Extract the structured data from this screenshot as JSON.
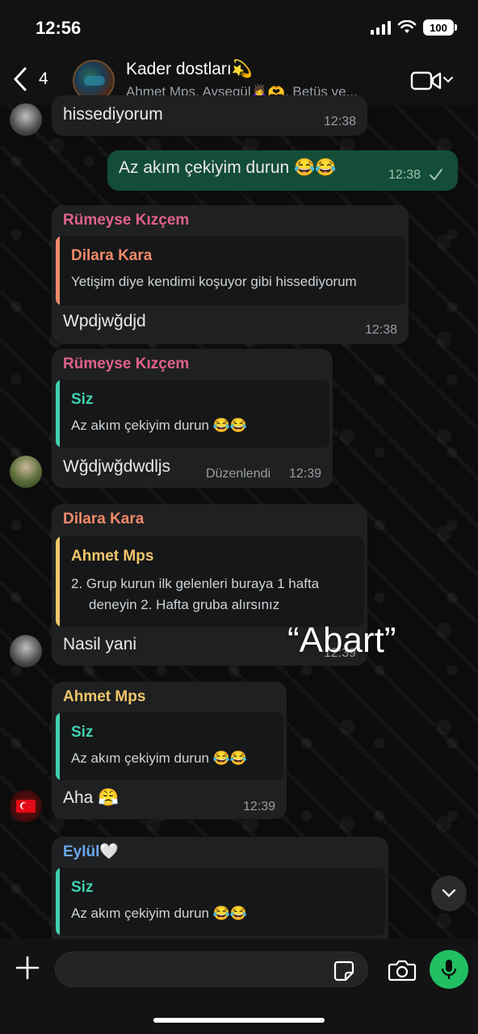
{
  "status_bar": {
    "time": "12:56",
    "battery": "100"
  },
  "header": {
    "back_count": "4",
    "title": "Kader dostları💫",
    "subtitle": "Ahmet Mps, Aysegül🙇‍♀️🫶, Betüş ve..."
  },
  "messages": [
    {
      "text": "hissediyorum",
      "time": "12:38"
    },
    {
      "text": "Az akım çekiyim durun 😂😂",
      "time": "12:38"
    },
    {
      "sender": "Rümeyse Kızçem",
      "quote": {
        "name": "Dilara Kara",
        "text": "Yetişim diye kendimi koşuyor gibi hissediyorum"
      },
      "text": "Wpdjwğdjd",
      "time": "12:38"
    },
    {
      "sender": "Rümeyse Kızçem",
      "quote": {
        "name": "Siz",
        "text": "Az akım çekiyim durun 😂😂"
      },
      "text": "Wğdjwğdwdljs",
      "edited": "Düzenlendi",
      "time": "12:39"
    },
    {
      "sender": "Dilara Kara",
      "quote": {
        "name": "Ahmet Mps",
        "line1": "2. Grup kurun ilk gelenleri buraya 1 hafta",
        "line2": "deneyin 2. Hafta gruba alırsınız"
      },
      "text": "Nasil yani",
      "time": "12:39"
    },
    {
      "sender": "Ahmet Mps",
      "quote": {
        "name": "Siz",
        "text": "Az akım çekiyim durun 😂😂"
      },
      "text": "Aha 😤",
      "time": "12:39"
    },
    {
      "sender": "Eylül🤍",
      "quote": {
        "name": "Siz",
        "text": "Az akım çekiyim durun 😂😂"
      }
    }
  ],
  "overlay_text": "“Abart”",
  "colors": {
    "sender_rumeyse": "#e0628a",
    "sender_dilara": "#f08a6a",
    "sender_ahmet": "#f0c66a",
    "sender_eylul": "#6aa8f0",
    "quote_siz": "#3fd1b0",
    "quote_dilara": "#f08a6a",
    "quote_ahmet": "#f0c66a",
    "outgoing_bubble": "#144d37",
    "mic_button": "#21c063"
  },
  "icons": {
    "back": "chevron-left-icon",
    "video": "video-call-icon",
    "plus": "plus-icon",
    "sticker": "sticker-icon",
    "camera": "camera-icon",
    "mic": "microphone-icon",
    "scroll_down": "chevron-down-icon"
  }
}
